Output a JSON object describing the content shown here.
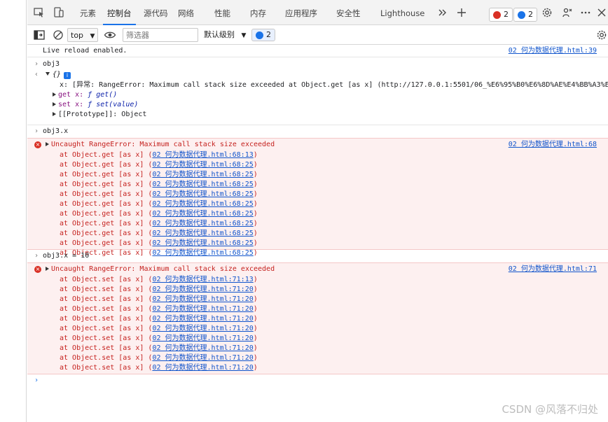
{
  "tabs": [
    "元素",
    "控制台",
    "源代码",
    "网络",
    "性能",
    "内存",
    "应用程序",
    "安全性",
    "Lighthouse"
  ],
  "badges": {
    "errors": "2",
    "messages": "2"
  },
  "toolbar": {
    "context": "top",
    "filter_placeholder": "筛选器",
    "level": "默认级别",
    "message_count": "2"
  },
  "console": {
    "live_reload": "Live reload enabled.",
    "live_reload_source": "02 何为数据代理.html:39",
    "cmd1": "obj3",
    "obj_header": "{}",
    "obj_x": "x: [异常: RangeError: Maximum call stack size exceeded at Object.get [as x] (http://127.0.0.1:5501/06_%E6%95%B0%E6%8D%AE%E4%BB%A3%E7",
    "obj_get_key": "get x: ",
    "obj_get_fn": "ƒ get()",
    "obj_set_key": "set x: ",
    "obj_set_fn": "ƒ set(value)",
    "obj_proto": "[[Prototype]]: Object",
    "cmd2": "obj3.x",
    "error1": {
      "message": "Uncaught RangeError: Maximum call stack size exceeded",
      "source": "02 何为数据代理.html:68",
      "frame_prefix": "at Object.get [as x] (",
      "frames": [
        "02 何为数据代理.html:68:13",
        "02 何为数据代理.html:68:25",
        "02 何为数据代理.html:68:25",
        "02 何为数据代理.html:68:25",
        "02 何为数据代理.html:68:25",
        "02 何为数据代理.html:68:25",
        "02 何为数据代理.html:68:25",
        "02 何为数据代理.html:68:25",
        "02 何为数据代理.html:68:25",
        "02 何为数据代理.html:68:25",
        "02 何为数据代理.html:68:25"
      ]
    },
    "cmd3": "obj3.x = 10",
    "error2": {
      "message": "Uncaught RangeError: Maximum call stack size exceeded",
      "source": "02 何为数据代理.html:71",
      "frame_prefix": "at Object.set [as x] (",
      "frames": [
        "02 何为数据代理.html:71:13",
        "02 何为数据代理.html:71:20",
        "02 何为数据代理.html:71:20",
        "02 何为数据代理.html:71:20",
        "02 何为数据代理.html:71:20",
        "02 何为数据代理.html:71:20",
        "02 何为数据代理.html:71:20",
        "02 何为数据代理.html:71:20",
        "02 何为数据代理.html:71:20",
        "02 何为数据代理.html:71:20"
      ]
    }
  },
  "watermark": "CSDN @风落不归处",
  "colors": {
    "error": "#c5221f",
    "link": "#1155cc",
    "accent": "#1a73e8",
    "error_bg": "#fdf0f0"
  }
}
